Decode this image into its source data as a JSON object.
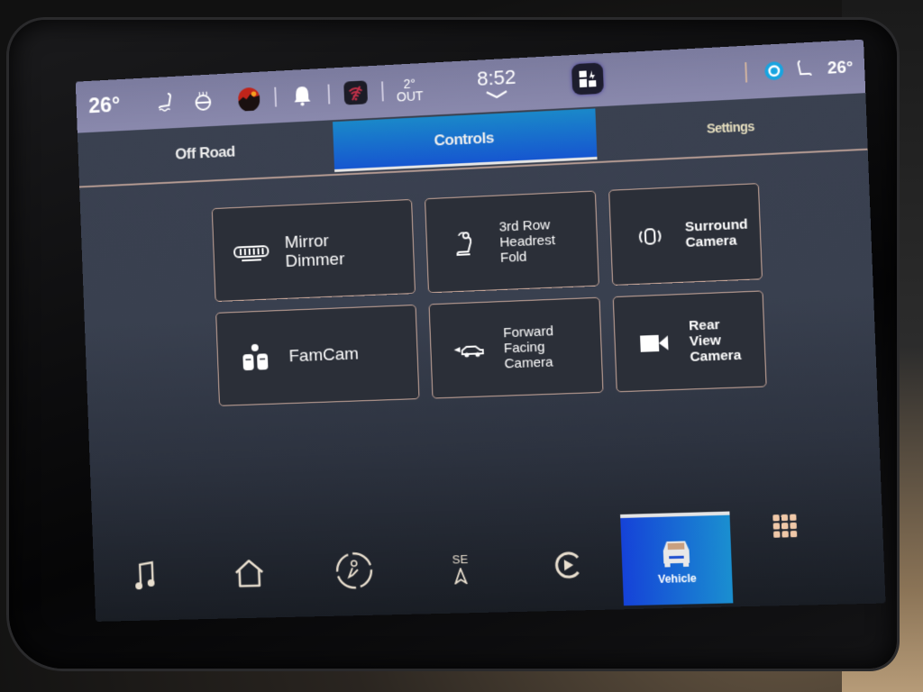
{
  "status_bar": {
    "driver_temp": "26°",
    "passenger_temp": "26°",
    "outside_temp": "2°",
    "outside_label": "OUT",
    "clock": "8:52",
    "icons": [
      "heated-seat-icon",
      "heated-steering-icon",
      "media-thumbnail-icon",
      "bell-icon",
      "wifi-off-icon",
      "apps-launcher-icon",
      "alexa-icon",
      "passenger-seat-icon"
    ]
  },
  "tabs": [
    {
      "label": "Off Road",
      "active": false
    },
    {
      "label": "Controls",
      "active": true
    },
    {
      "label": "Settings",
      "active": false
    }
  ],
  "controls": [
    {
      "label": "Mirror Dimmer",
      "icon": "mirror-dimmer-icon"
    },
    {
      "label": "3rd Row Headrest Fold",
      "icon": "headrest-fold-icon"
    },
    {
      "label": "Surround Camera",
      "icon": "surround-camera-icon"
    },
    {
      "label": "FamCam",
      "icon": "famcam-icon"
    },
    {
      "label": "Forward Facing Camera",
      "icon": "forward-camera-icon"
    },
    {
      "label": "Rear View Camera",
      "icon": "rear-camera-icon"
    }
  ],
  "dock": {
    "items": [
      {
        "name": "media",
        "icon": "music-note-icon"
      },
      {
        "name": "home",
        "icon": "home-icon"
      },
      {
        "name": "climate",
        "icon": "climate-icon"
      },
      {
        "name": "navigation",
        "icon": "nav-arrow-icon",
        "heading": "SE"
      },
      {
        "name": "projection",
        "icon": "play-circle-icon"
      },
      {
        "name": "vehicle",
        "icon": "vehicle-icon",
        "label": "Vehicle",
        "active": true
      },
      {
        "name": "apps",
        "icon": "app-grid-icon"
      }
    ]
  },
  "colors": {
    "status_bar": "#8a89ad",
    "active_tab": "#1656d0",
    "tile_border": "#c9a89b",
    "tile_bg": "#2b2f38"
  }
}
